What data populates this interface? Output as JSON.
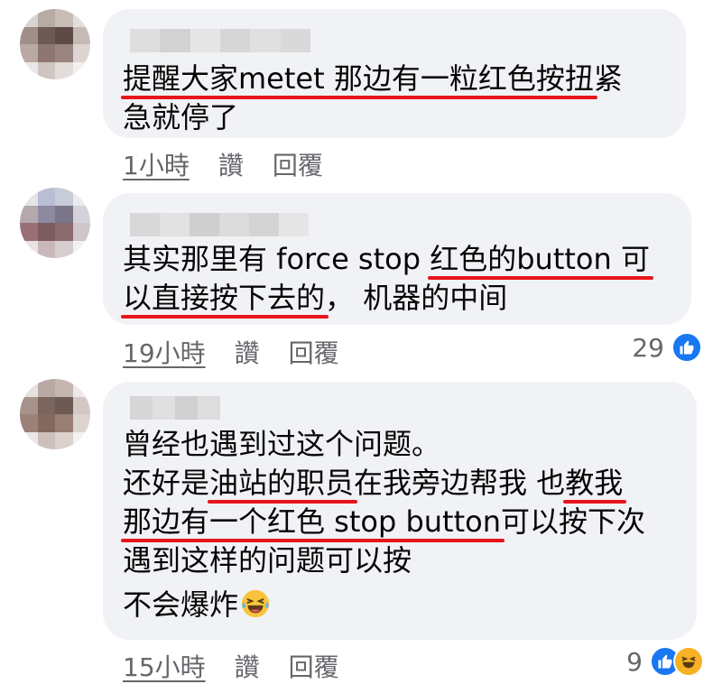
{
  "comments": [
    {
      "lines": [
        [
          {
            "t": "提醒大家metet 那边有一粒红色按扭",
            "u": true
          },
          {
            "t": "紧",
            "u": false
          }
        ],
        [
          {
            "t": "急就停了",
            "u": false
          }
        ]
      ],
      "time": "1小時",
      "like": "讚",
      "reply": "回覆",
      "reaction_count": "",
      "reactions": []
    },
    {
      "lines": [
        [
          {
            "t": "其实那里有 force stop ",
            "u": false
          },
          {
            "t": "红色的button 可",
            "u": true
          }
        ],
        [
          {
            "t": "以直接按下去的",
            "u": true
          },
          {
            "t": "， 机器的中间",
            "u": false
          }
        ]
      ],
      "time": "19小時",
      "like": "讚",
      "reply": "回覆",
      "reaction_count": "29",
      "reactions": [
        "like-icon"
      ]
    },
    {
      "lines": [
        [
          {
            "t": "曾经也遇到过这个问题。",
            "u": false
          }
        ],
        [
          {
            "t": "还好是",
            "u": false
          },
          {
            "t": "油站的职员",
            "u": true
          },
          {
            "t": "在我旁边帮我 也",
            "u": false
          },
          {
            "t": "教我",
            "u": true
          }
        ],
        [
          {
            "t": "那边有一个红色 stop button",
            "u": true
          },
          {
            "t": "可以按下次",
            "u": false
          }
        ],
        [
          {
            "t": "遇到这样的问题可以按",
            "u": false
          }
        ],
        [
          {
            "t": "不会爆炸",
            "u": false
          }
        ]
      ],
      "time": "15小時",
      "like": "讚",
      "reply": "回覆",
      "reaction_count": "9",
      "reactions": [
        "like-icon",
        "haha-icon"
      ]
    }
  ],
  "colors": {
    "bubble": "#f0f2f5",
    "underline": "#e8141c",
    "secondary_text": "#65676b",
    "like_blue": "#1877f2",
    "haha_yellow": "#f7b125"
  }
}
